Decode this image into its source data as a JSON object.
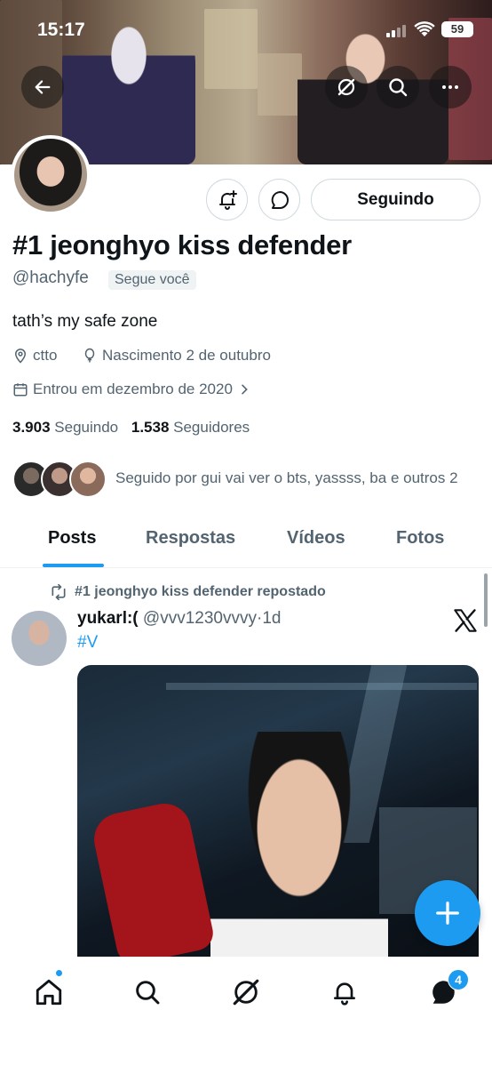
{
  "status_bar": {
    "time": "15:17",
    "battery": "59"
  },
  "profile": {
    "display_name": "#1 jeonghyo kiss defender",
    "handle": "@hachyfe",
    "follows_you": "Segue você",
    "bio": "tath’s my safe zone",
    "location": "ctto",
    "birthday": "Nascimento 2 de outubro",
    "joined": "Entrou em dezembro de 2020",
    "following_count": "3.903",
    "following_label": "Seguindo",
    "followers_count": "1.538",
    "followers_label": "Seguidores",
    "followed_by": "Seguido por gui vai ver o bts, yassss, ba e outros 2",
    "follow_button": "Seguindo"
  },
  "tabs": [
    {
      "label": "Posts",
      "active": true
    },
    {
      "label": "Respostas",
      "active": false
    },
    {
      "label": "Vídeos",
      "active": false
    },
    {
      "label": "Fotos",
      "active": false
    }
  ],
  "post": {
    "repost_label": "#1 jeonghyo kiss defender repostado",
    "author": "yukarl:(",
    "author_handle": "@vvv1230vvvy",
    "separator": "·",
    "time": "1d",
    "hashtag": "#V"
  },
  "bottom_nav": {
    "items": [
      "home-icon",
      "search-icon",
      "grok-icon",
      "bell-icon",
      "messages-icon"
    ],
    "messages_badge": "4"
  },
  "colors": {
    "accent": "#1d9bf0",
    "text": "#0f1419",
    "muted": "#536471"
  }
}
